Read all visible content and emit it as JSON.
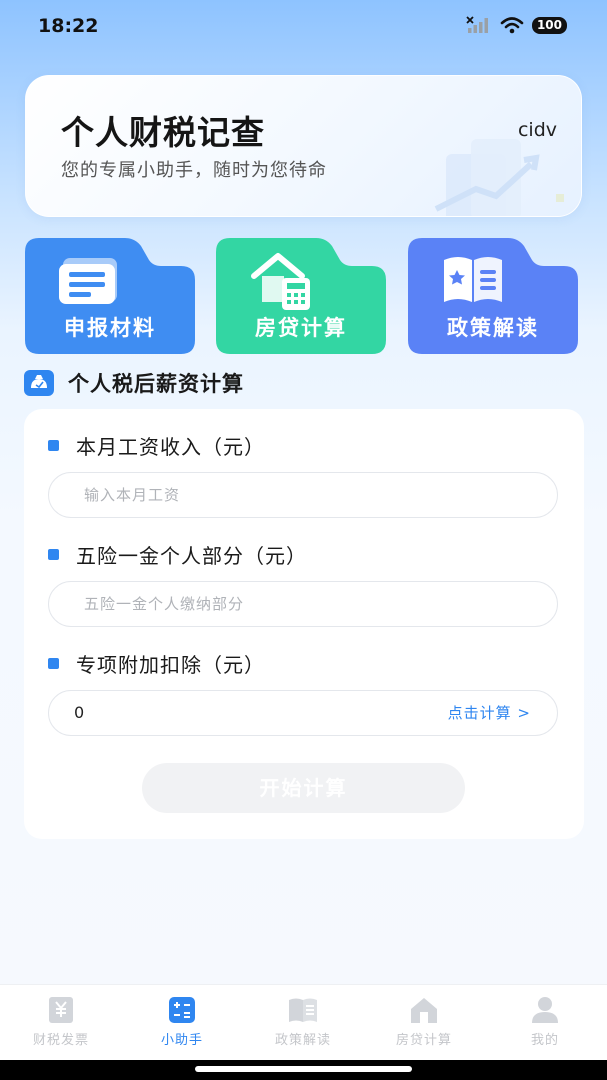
{
  "status_bar": {
    "time": "18:22",
    "battery": "100"
  },
  "hero": {
    "title": "个人财税记查",
    "subtitle": "您的专属小助手，随时为您待命",
    "user": "cidv"
  },
  "tiles": [
    {
      "label": "申报材料",
      "color": "#3f8df2",
      "icon": "document-list-icon"
    },
    {
      "label": "房贷计算",
      "color": "#33d6a3",
      "icon": "house-calculator-icon"
    },
    {
      "label": "政策解读",
      "color": "#5a82f6",
      "icon": "policy-book-icon"
    }
  ],
  "section": {
    "title": "个人税后薪资计算",
    "icon": "salary-calc-icon"
  },
  "form": {
    "salary": {
      "label": "本月工资收入（元）",
      "placeholder": "输入本月工资"
    },
    "insurance": {
      "label": "五险一金个人部分（元）",
      "placeholder": "五险一金个人缴纳部分"
    },
    "deduction": {
      "label": "专项附加扣除（元）",
      "value": "0",
      "link": "点击计算 >"
    },
    "submit": "开始计算"
  },
  "tabbar": {
    "items": [
      {
        "label": "财税发票",
        "icon": "invoice-icon",
        "active": false
      },
      {
        "label": "小助手",
        "icon": "calculator-icon",
        "active": true
      },
      {
        "label": "政策解读",
        "icon": "book-icon",
        "active": false
      },
      {
        "label": "房贷计算",
        "icon": "house-icon",
        "active": false
      },
      {
        "label": "我的",
        "icon": "profile-icon",
        "active": false
      }
    ]
  },
  "colors": {
    "accent": "#2f86f0",
    "inactive": "#c4c6ca"
  }
}
